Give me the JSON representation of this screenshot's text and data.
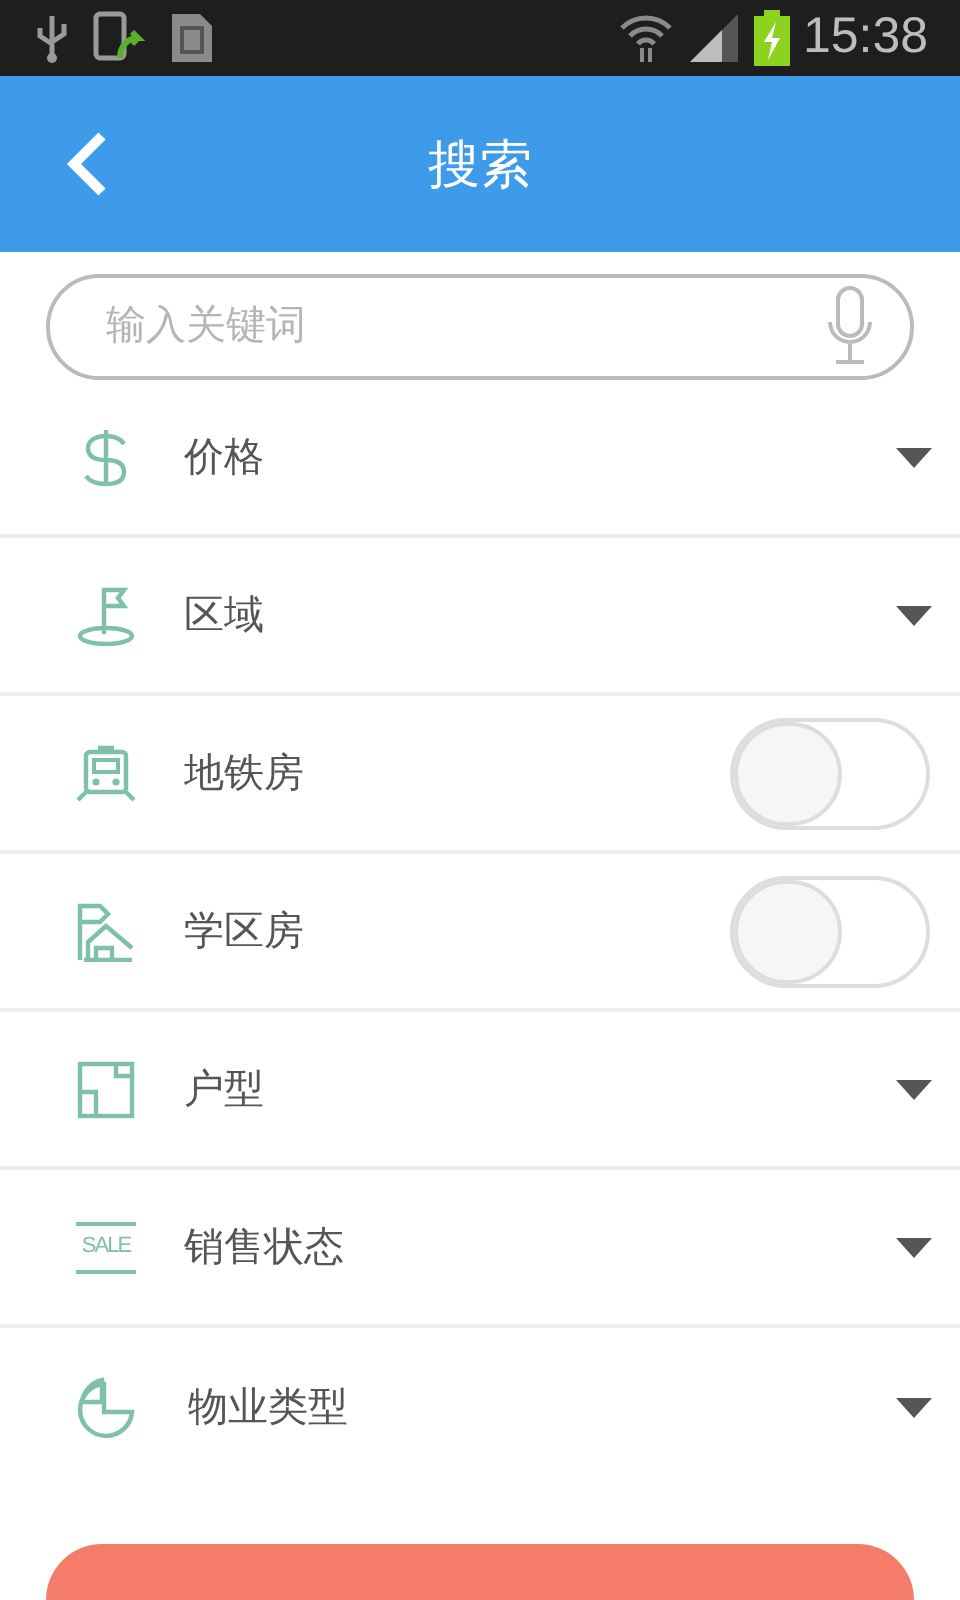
{
  "status_bar": {
    "time": "15:38"
  },
  "header": {
    "title": "搜索"
  },
  "search": {
    "placeholder": "输入关键词"
  },
  "filters": [
    {
      "kind": "dropdown",
      "label": "价格"
    },
    {
      "kind": "dropdown",
      "label": "区域"
    },
    {
      "kind": "toggle",
      "label": "地铁房",
      "on": false
    },
    {
      "kind": "toggle",
      "label": "学区房",
      "on": false
    },
    {
      "kind": "dropdown",
      "label": "户型"
    },
    {
      "kind": "dropdown",
      "icon_text": "SALE",
      "label": "销售状态"
    },
    {
      "kind": "dropdown",
      "label": "物业类型"
    }
  ],
  "submit": {
    "kind": "button"
  }
}
